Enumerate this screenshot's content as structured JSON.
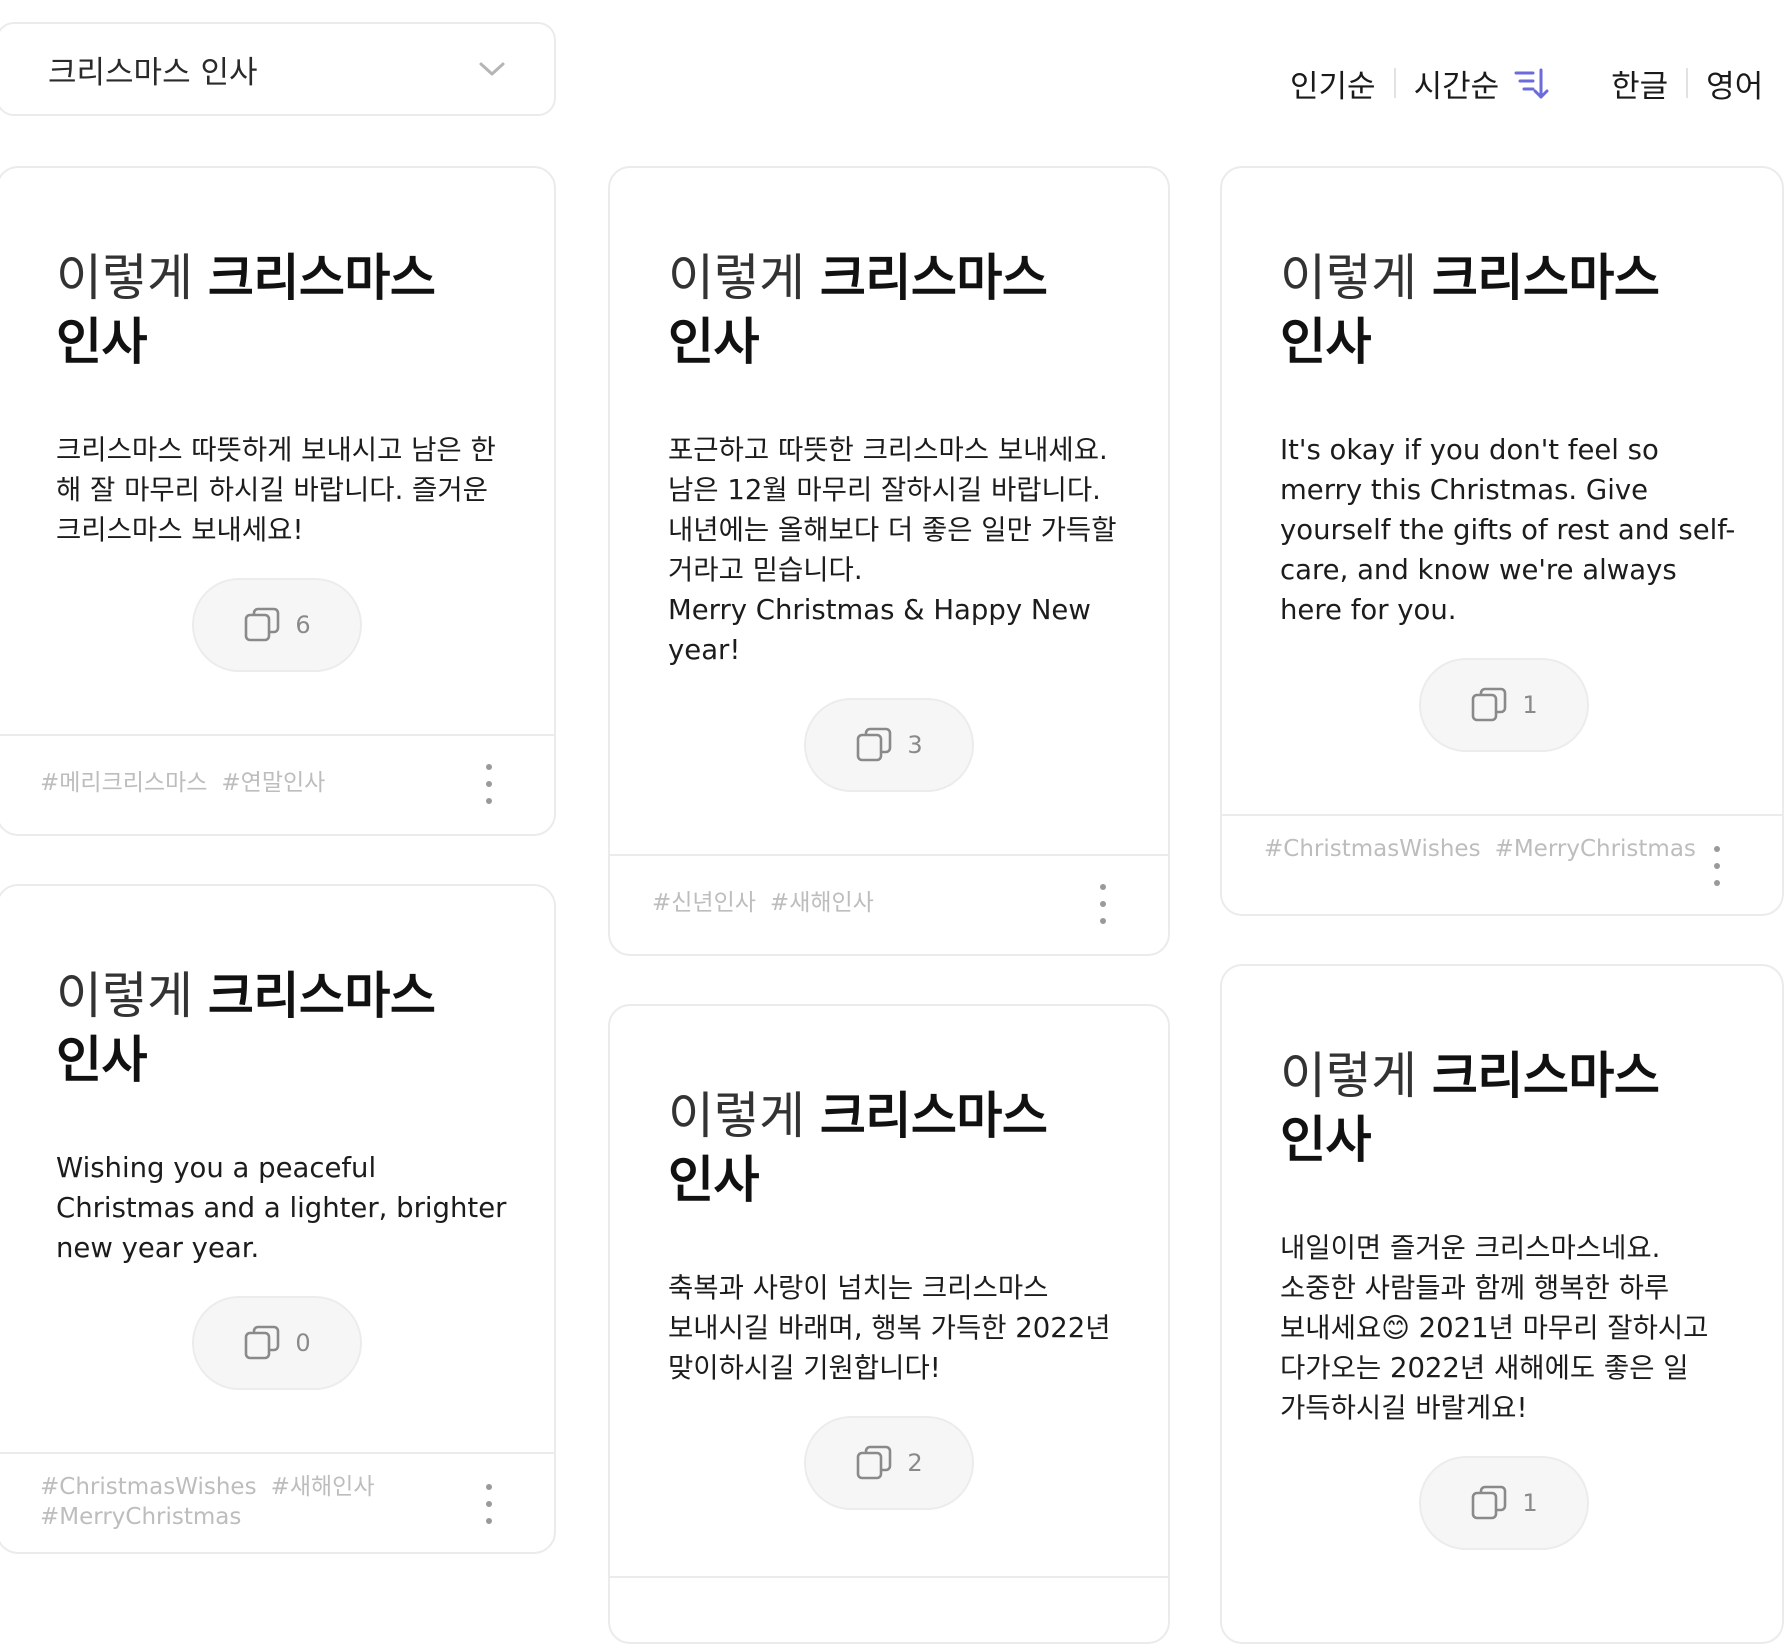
{
  "dropdown": {
    "selected": "크리스마스 인사"
  },
  "sort": {
    "popular": "인기순",
    "recent": "시간순"
  },
  "language": {
    "korean": "한글",
    "english": "영어"
  },
  "colors": {
    "accent": "#6b6bdb",
    "tag": "#bdbdbd",
    "border": "#ebebeb"
  },
  "cards": [
    {
      "title_light": "이렇게 ",
      "title_bold": "크리스마스 인사",
      "text": "크리스마스 따뜻하게 보내시고 남은 한 해 잘 마무리 하시길 바랍니다. 즐거운 크리스마스 보내세요!",
      "count": "6",
      "tags": [
        "#메리크리스마스",
        "#연말인사"
      ]
    },
    {
      "title_light": "이렇게 ",
      "title_bold": "크리스마스 인사",
      "text": "포근하고 따뜻한 크리스마스 보내세요. 남은 12월 마무리 잘하시길 바랍니다. 내년에는 올해보다 더 좋은 일만 가득할 거라고 믿습니다.\nMerry Christmas & Happy New year!",
      "count": "3",
      "tags": [
        "#신년인사",
        "#새해인사"
      ]
    },
    {
      "title_light": "이렇게 ",
      "title_bold": "크리스마스 인사",
      "text": "It's okay if you don't feel so merry this Christmas. Give yourself the gifts of rest and self-care, and know we're always here for you.",
      "count": "1",
      "tags": [
        "#ChristmasWishes",
        "#MerryChristmas"
      ]
    },
    {
      "title_light": "이렇게 ",
      "title_bold": "크리스마스 인사",
      "text": "Wishing you a peaceful Christmas and a lighter, brighter new year year.",
      "count": "0",
      "tags": [
        "#ChristmasWishes",
        "#새해인사",
        "#MerryChristmas"
      ]
    },
    {
      "title_light": "이렇게 ",
      "title_bold": "크리스마스 인사",
      "text": "축복과 사랑이 넘치는 크리스마스 보내시길 바래며, 행복 가득한 2022년 맞이하시길 기원합니다!",
      "count": "2",
      "tags": []
    },
    {
      "title_light": "이렇게 ",
      "title_bold": "크리스마스 인사",
      "text": "내일이면 즐거운 크리스마스네요. 소중한 사람들과 함께 행복한 하루 보내세요😊 2021년 마무리 잘하시고 다가오는 2022년 새해에도 좋은 일 가득하시길 바랄게요!",
      "count": "1",
      "tags": []
    }
  ]
}
